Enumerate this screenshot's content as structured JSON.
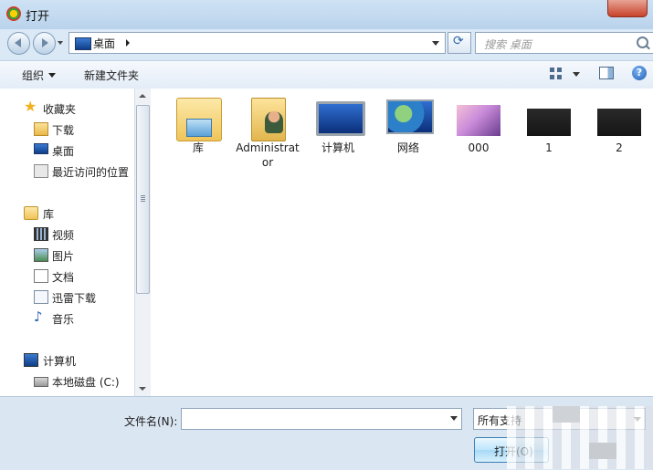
{
  "window": {
    "title": "打开"
  },
  "address": {
    "location": "桌面"
  },
  "search": {
    "placeholder": "搜索 桌面"
  },
  "toolbar": {
    "organize_label": "组织",
    "new_folder_label": "新建文件夹"
  },
  "help": {
    "glyph": "?"
  },
  "nav": {
    "favorites": "收藏夹",
    "downloads": "下载",
    "desktop": "桌面",
    "recent": "最近访问的位置",
    "libraries": "库",
    "videos": "视频",
    "pictures": "图片",
    "documents": "文档",
    "xunlei": "迅雷下载",
    "music": "音乐",
    "computer": "计算机",
    "local_disk": "本地磁盘 (C:)"
  },
  "files": [
    {
      "name": "库",
      "icon": "library-icon"
    },
    {
      "name": "Administrator",
      "icon": "user-folder-icon"
    },
    {
      "name": "计算机",
      "icon": "computer-icon"
    },
    {
      "name": "网络",
      "icon": "network-icon"
    },
    {
      "name": "000",
      "icon": "image-thumbnail"
    },
    {
      "name": "1",
      "icon": "image-thumbnail"
    },
    {
      "name": "2",
      "icon": "image-thumbnail"
    }
  ],
  "bottom": {
    "filename_label": "文件名(N):",
    "filename_value": "",
    "filetype_value": "所有支持",
    "open_label": "打开(O)"
  }
}
